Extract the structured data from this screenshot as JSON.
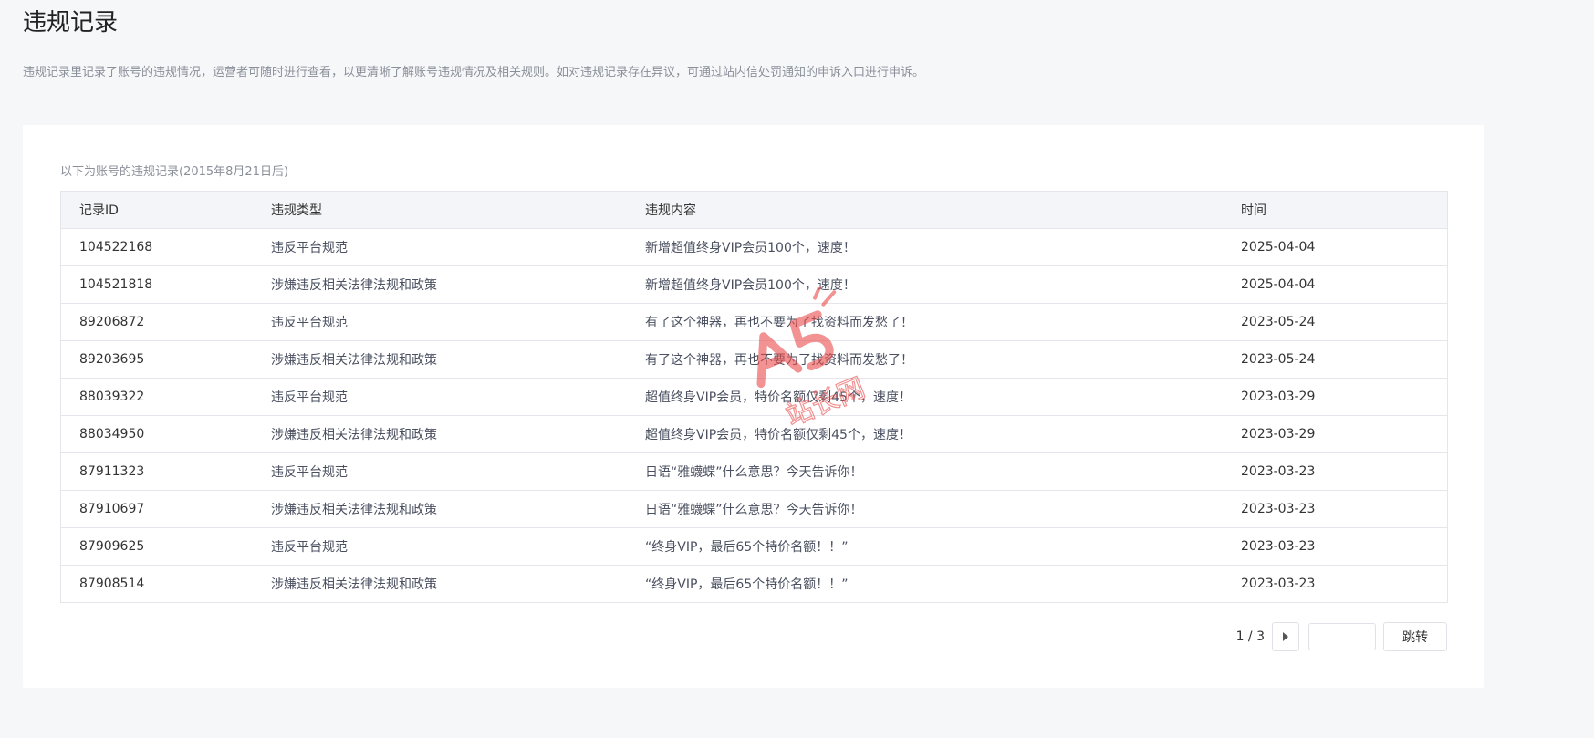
{
  "page": {
    "title": "违规记录",
    "description": "违规记录里记录了账号的违规情况，运营者可随时进行查看，以更清晰了解账号违规情况及相关规则。如对违规记录存在异议，可通过站内信处罚通知的申诉入口进行申诉。"
  },
  "card": {
    "subtitle": "以下为账号的违规记录(2015年8月21日后)"
  },
  "table": {
    "headers": {
      "id": "记录ID",
      "type": "违规类型",
      "content": "违规内容",
      "time": "时间"
    },
    "rows": [
      {
        "id": "104522168",
        "type": "违反平台规范",
        "content": "新增超值终身VIP会员100个，速度！",
        "time": "2025-04-04"
      },
      {
        "id": "104521818",
        "type": "涉嫌违反相关法律法规和政策",
        "content": "新增超值终身VIP会员100个，速度！",
        "time": "2025-04-04"
      },
      {
        "id": "89206872",
        "type": "违反平台规范",
        "content": "有了这个神器，再也不要为了找资料而发愁了！",
        "time": "2023-05-24"
      },
      {
        "id": "89203695",
        "type": "涉嫌违反相关法律法规和政策",
        "content": "有了这个神器，再也不要为了找资料而发愁了！",
        "time": "2023-05-24"
      },
      {
        "id": "88039322",
        "type": "违反平台规范",
        "content": "超值终身VIP会员，特价名额仅剩45个，速度！",
        "time": "2023-03-29"
      },
      {
        "id": "88034950",
        "type": "涉嫌违反相关法律法规和政策",
        "content": "超值终身VIP会员，特价名额仅剩45个，速度！",
        "time": "2023-03-29"
      },
      {
        "id": "87911323",
        "type": "违反平台规范",
        "content": "日语“雅蠛蝶”什么意思？今天告诉你！",
        "time": "2023-03-23"
      },
      {
        "id": "87910697",
        "type": "涉嫌违反相关法律法规和政策",
        "content": "日语“雅蠛蝶”什么意思？今天告诉你！",
        "time": "2023-03-23"
      },
      {
        "id": "87909625",
        "type": "违反平台规范",
        "content": "“终身VIP，最后65个特价名额！！”",
        "time": "2023-03-23"
      },
      {
        "id": "87908514",
        "type": "涉嫌违反相关法律法规和政策",
        "content": "“终身VIP，最后65个特价名额！！”",
        "time": "2023-03-23"
      }
    ]
  },
  "pager": {
    "info": "1 / 3",
    "input_value": "",
    "jump_label": "跳转",
    "next_icon": "caret-right-icon"
  },
  "watermark": {
    "text_top": "A5",
    "text_bottom": "站长网",
    "color": "#e84a4a"
  }
}
